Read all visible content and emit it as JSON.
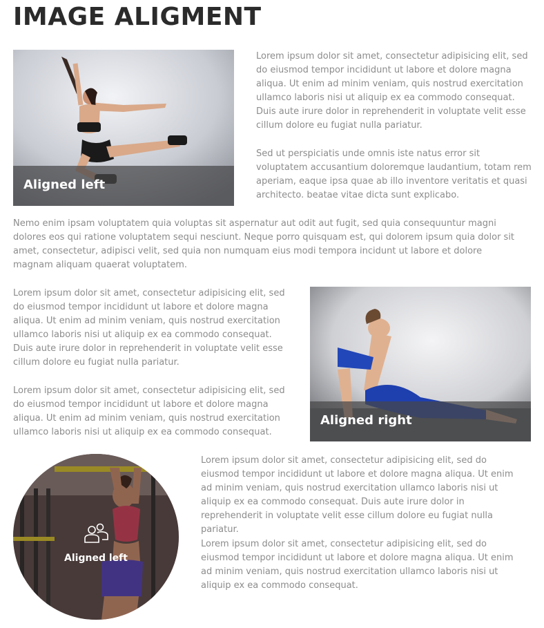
{
  "page": {
    "title": "IMAGE ALIGMENT"
  },
  "section1": {
    "caption": "Aligned left",
    "p1": "Lorem ipsum dolor sit amet, consectetur adipisicing elit, sed do eiusmod tempor incididunt ut labore et dolore magna aliqua. Ut enim ad minim veniam, quis nostrud exercitation ullamco laboris nisi ut aliquip ex ea commodo consequat. Duis aute irure dolor in reprehenderit in voluptate velit esse cillum dolore eu fugiat nulla pariatur.",
    "p2": "Sed ut perspiciatis unde omnis iste natus error sit voluptatem accusantium doloremque laudantium, totam rem aperiam, eaque ipsa quae ab illo inventore veritatis et quasi architecto. beatae vitae dicta sunt explicabo."
  },
  "fullwidth": {
    "p": "Nemo enim ipsam voluptatem quia voluptas sit aspernatur aut odit aut fugit, sed quia consequuntur magni dolores eos qui ratione voluptatem sequi nesciunt. Neque porro quisquam est, qui dolorem ipsum quia dolor sit amet, consectetur, adipisci velit, sed quia non numquam eius modi tempora incidunt ut labore et dolore magnam aliquam quaerat voluptatem."
  },
  "section2": {
    "caption": "Aligned right",
    "p1": "Lorem ipsum dolor sit amet, consectetur adipisicing elit, sed do eiusmod tempor incididunt ut labore et dolore magna aliqua. Ut enim ad minim veniam, quis nostrud exercitation ullamco laboris nisi ut aliquip ex ea commodo consequat. Duis aute irure dolor in reprehenderit in voluptate velit esse cillum dolore eu fugiat nulla pariatur.",
    "p2": "Lorem ipsum dolor sit amet, consectetur adipisicing elit, sed do eiusmod tempor incididunt ut labore et dolore magna aliqua. Ut enim ad minim veniam, quis nostrud exercitation ullamco laboris nisi ut aliquip ex ea commodo consequat."
  },
  "section3": {
    "caption": "Aligned left",
    "icon": "users-icon",
    "p1": "Lorem ipsum dolor sit amet, consectetur adipisicing elit, sed do eiusmod tempor incididunt ut labore et dolore magna aliqua. Ut enim ad minim veniam, quis nostrud exercitation ullamco laboris nisi ut aliquip ex ea commodo consequat. Duis aute irure dolor in reprehenderit in voluptate velit esse cillum dolore eu fugiat nulla pariatur.",
    "p2": "Lorem ipsum dolor sit amet, consectetur adipisicing elit, sed do eiusmod tempor incididunt ut labore et dolore magna aliqua. Ut enim ad minim veniam, quis nostrud exercitation ullamco laboris nisi ut aliquip ex ea commodo consequat."
  }
}
